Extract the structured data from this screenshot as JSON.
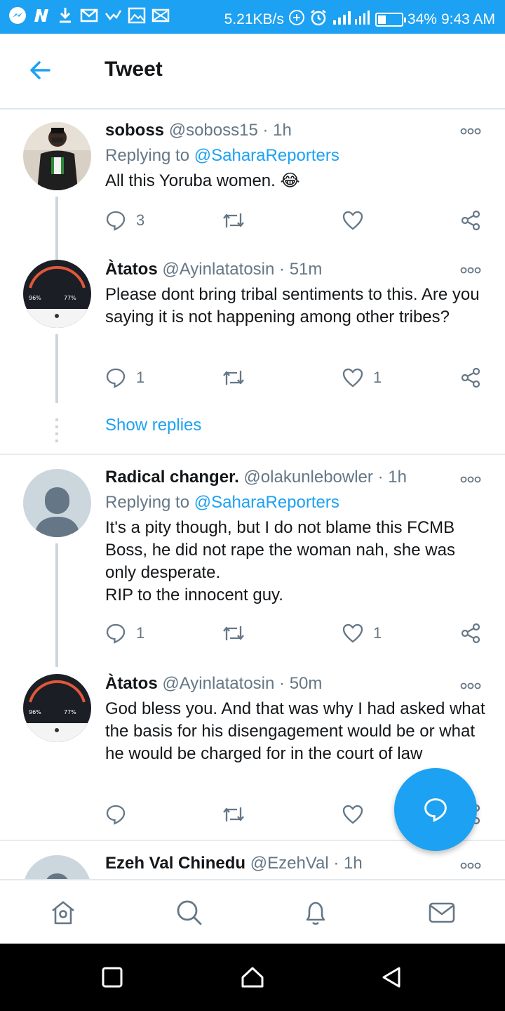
{
  "status_bar": {
    "speed": "5.21KB/s",
    "battery": "34%",
    "battery_level": 0.34,
    "time": "9:43 AM",
    "icons": [
      "messenger-icon",
      "news-icon",
      "download-icon",
      "gmail-icon",
      "check-icon",
      "image-icon",
      "mail-off-icon"
    ]
  },
  "header": {
    "title": "Tweet"
  },
  "tweets": [
    {
      "name": "soboss",
      "handle": "@soboss15",
      "time": "· 1h",
      "replying_label": "Replying to",
      "replying_handle": "@SaharaReporters",
      "text": "All this Yoruba women. 😂",
      "reply_count": "3",
      "retweet_count": "",
      "like_count": ""
    },
    {
      "name": "Àtatos",
      "handle": "@Ayinlatatosin",
      "time": "· 51m",
      "text": "Please dont bring tribal sentiments to this. Are you saying it is not happening among other tribes?",
      "reply_count": "1",
      "retweet_count": "",
      "like_count": "1"
    },
    {
      "name": "Radical changer.",
      "handle": "@olakunlebowler",
      "time": "· 1h",
      "replying_label": "Replying to",
      "replying_handle": "@SaharaReporters",
      "text_lines": [
        "It's a pity though, but I do not blame this FCMB",
        "Boss, he did not rape the woman nah, she was",
        "only desperate.",
        "RIP to the innocent guy."
      ],
      "reply_count": "1",
      "retweet_count": "",
      "like_count": "1"
    },
    {
      "name": "Àtatos",
      "handle": "@Ayinlatatosin",
      "time": "· 50m",
      "text": "God bless you. And that was why I had asked what the basis for his disengagement would be or what he would be charged for in the court of law",
      "reply_count": "",
      "retweet_count": "",
      "like_count": ""
    },
    {
      "name": "Ezeh Val Chinedu",
      "handle": "@EzehVal",
      "time": "· 1h"
    }
  ],
  "show_replies": "Show replies",
  "colors": {
    "accent": "#1da1f2",
    "muted": "#657786",
    "text": "#14171a",
    "border": "#e1e8ed"
  },
  "bottom_nav": [
    "home-icon",
    "search-icon",
    "notifications-icon",
    "messages-icon"
  ],
  "system_nav": [
    "recents-icon",
    "home-circle-icon",
    "back-triangle-icon"
  ]
}
